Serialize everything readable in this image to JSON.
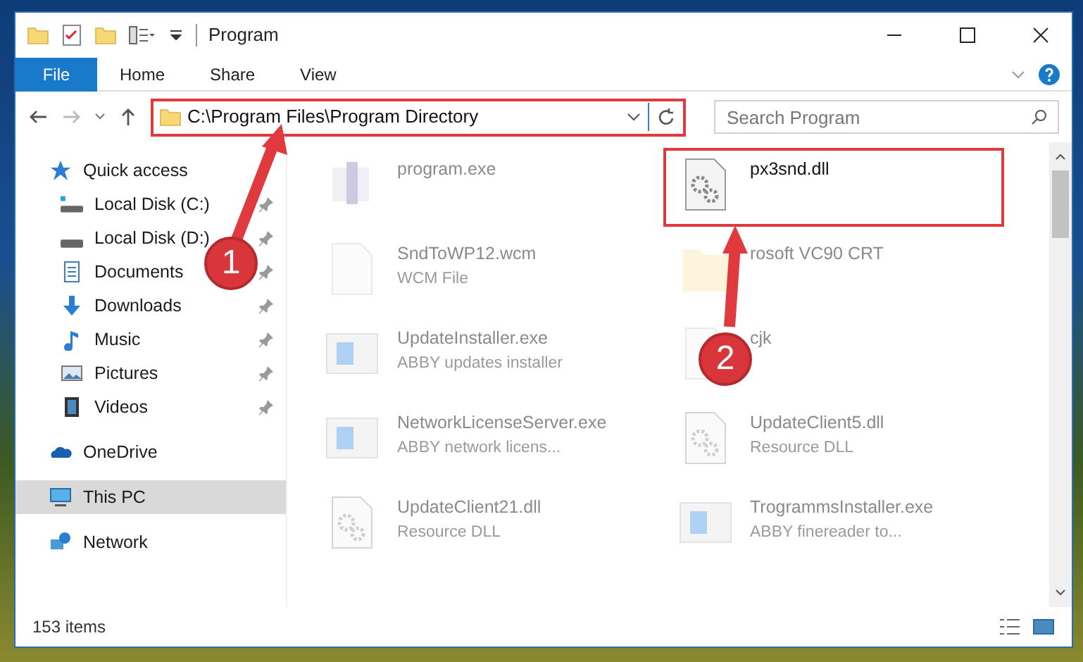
{
  "window": {
    "title": "Program"
  },
  "ribbon_tabs": [
    {
      "label": "File",
      "kind": "file_menu",
      "selected": false
    },
    {
      "label": "Home",
      "kind": "tab",
      "selected": false
    },
    {
      "label": "Share",
      "kind": "tab",
      "selected": false
    },
    {
      "label": "View",
      "kind": "tab",
      "selected": false
    }
  ],
  "address_bar": {
    "path": "C:\\Program Files\\Program Directory"
  },
  "search": {
    "placeholder": "Search Program"
  },
  "sidebar": {
    "items": [
      {
        "label": "Quick access",
        "kind": "quick",
        "selected": false,
        "children": [
          {
            "label": "Local Disk (C:)",
            "kind": "disk_c",
            "pinned": true,
            "selected": false
          },
          {
            "label": "Local Disk (D:)",
            "kind": "disk",
            "pinned": true,
            "selected": false
          },
          {
            "label": "Documents",
            "kind": "documents",
            "pinned": true,
            "selected": false
          },
          {
            "label": "Downloads",
            "kind": "downloads",
            "pinned": true,
            "selected": false
          },
          {
            "label": "Music",
            "kind": "music",
            "pinned": true,
            "selected": false
          },
          {
            "label": "Pictures",
            "kind": "pictures",
            "pinned": true,
            "selected": false
          },
          {
            "label": "Videos",
            "kind": "videos",
            "pinned": true,
            "selected": false
          }
        ]
      },
      {
        "label": "OneDrive",
        "kind": "cloud",
        "selected": false
      },
      {
        "label": "This PC",
        "kind": "pc",
        "selected": true
      },
      {
        "label": "Network",
        "kind": "network",
        "selected": false
      }
    ]
  },
  "files": [
    {
      "name": "program.exe",
      "kind": "exe",
      "faded": true,
      "highlighted": false
    },
    {
      "name": "px3snd.dll",
      "kind": "dll",
      "faded": false,
      "highlighted": true
    },
    {
      "name": "SndToWP12.wcm",
      "description": "WCM File",
      "kind": "blank",
      "faded": true,
      "highlighted": false
    },
    {
      "name": "rosoft VC90 CRT",
      "kind": "folder",
      "faded": true,
      "highlighted": false
    },
    {
      "name": "UpdateInstaller.exe",
      "description": "ABBY updates installer",
      "kind": "installer",
      "faded": true,
      "highlighted": false
    },
    {
      "name": "cjk",
      "kind": "blank",
      "faded": true,
      "highlighted": false
    },
    {
      "name": "NetworkLicenseServer.exe",
      "description": "ABBY network licens...",
      "kind": "installer",
      "faded": true,
      "highlighted": false
    },
    {
      "name": "UpdateClient5.dll",
      "description": "Resource DLL",
      "kind": "dll",
      "faded": true,
      "highlighted": false
    },
    {
      "name": "UpdateClient21.dll",
      "description": "Resource DLL",
      "kind": "dll",
      "faded": true,
      "highlighted": false
    },
    {
      "name": "TrogrammsInstaller.exe",
      "description": "ABBY finereader to...",
      "kind": "installer",
      "faded": true,
      "highlighted": false
    }
  ],
  "callouts": [
    {
      "number": "1"
    },
    {
      "number": "2"
    }
  ],
  "status_bar": {
    "count": "153 items"
  }
}
